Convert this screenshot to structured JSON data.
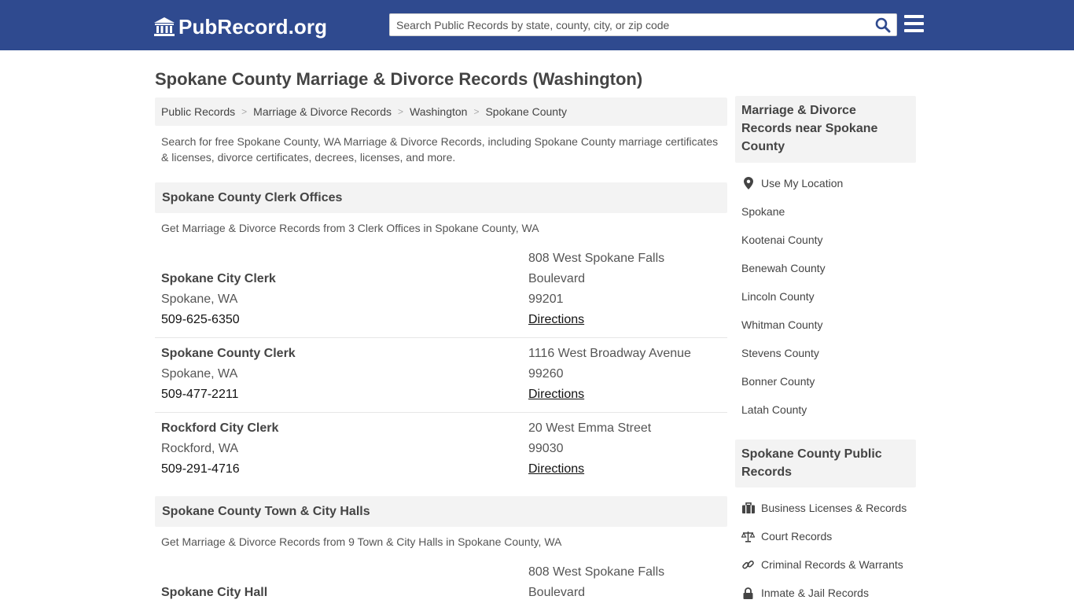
{
  "header": {
    "logo_text": "PubRecord.org",
    "search_placeholder": "Search Public Records by state, county, city, or zip code"
  },
  "page_title": "Spokane County Marriage & Divorce Records (Washington)",
  "breadcrumb": [
    "Public Records",
    "Marriage & Divorce Records",
    "Washington",
    "Spokane County"
  ],
  "intro": "Search for free Spokane County, WA Marriage & Divorce Records, including Spokane County marriage certificates & licenses, divorce certificates, decrees, licenses, and more.",
  "clerk_section": {
    "title": "Spokane County Clerk Offices",
    "subtitle": "Get Marriage & Divorce Records from 3 Clerk Offices in Spokane County, WA",
    "offices": [
      {
        "name": "Spokane City Clerk",
        "location": "Spokane, WA",
        "phone": "509-625-6350",
        "address1": "808 West Spokane Falls",
        "address2": "Boulevard",
        "zip": "99201",
        "directions": "Directions"
      },
      {
        "name": "Spokane County Clerk",
        "location": "Spokane, WA",
        "phone": "509-477-2211",
        "address1": "1116 West Broadway Avenue",
        "zip": "99260",
        "directions": "Directions"
      },
      {
        "name": "Rockford City Clerk",
        "location": "Rockford, WA",
        "phone": "509-291-4716",
        "address1": "20 West Emma Street",
        "zip": "99030",
        "directions": "Directions"
      }
    ]
  },
  "hall_section": {
    "title": "Spokane County Town & City Halls",
    "subtitle": "Get Marriage & Divorce Records from 9 Town & City Halls in Spokane County, WA",
    "offices": [
      {
        "name": "Spokane City Hall",
        "address1": "808 West Spokane Falls",
        "address2": "Boulevard"
      }
    ]
  },
  "sidebar": {
    "nearby_title": "Marriage & Divorce Records near Spokane County",
    "use_location": "Use My Location",
    "nearby": [
      "Spokane",
      "Kootenai County",
      "Benewah County",
      "Lincoln County",
      "Whitman County",
      "Stevens County",
      "Bonner County",
      "Latah County"
    ],
    "public_title": "Spokane County Public Records",
    "public_links": [
      {
        "label": "Business Licenses & Records",
        "icon": "briefcase-icon"
      },
      {
        "label": "Court Records",
        "icon": "scales-icon"
      },
      {
        "label": "Criminal Records & Warrants",
        "icon": "link-icon"
      },
      {
        "label": "Inmate & Jail Records",
        "icon": "lock-icon"
      }
    ]
  },
  "colors": {
    "header_bg": "#2f4a8f",
    "panel_bg": "#f3f3f3",
    "search_icon": "#2f4a8f"
  }
}
